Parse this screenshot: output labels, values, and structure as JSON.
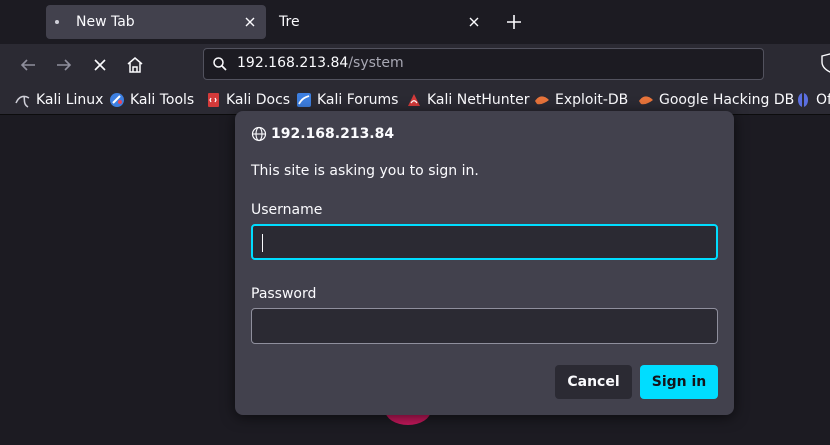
{
  "tabs": [
    {
      "title": "New Tab",
      "active": true
    },
    {
      "title": "Tre",
      "active": false
    }
  ],
  "urlbar": {
    "host": "192.168.213.84",
    "path": "/system"
  },
  "bookmarks": [
    {
      "label": "Kali Linux",
      "icon": "kali-dragon-icon"
    },
    {
      "label": "Kali Tools",
      "icon": "kali-tools-icon"
    },
    {
      "label": "Kali Docs",
      "icon": "kali-docs-icon"
    },
    {
      "label": "Kali Forums",
      "icon": "kali-forums-icon"
    },
    {
      "label": "Kali NetHunter",
      "icon": "nethunter-icon"
    },
    {
      "label": "Exploit-DB",
      "icon": "exploit-db-icon"
    },
    {
      "label": "Google Hacking DB",
      "icon": "ghdb-icon"
    },
    {
      "label": "Of",
      "icon": "offsec-icon"
    }
  ],
  "dialog": {
    "host": "192.168.213.84",
    "message": "This site is asking you to sign in.",
    "username_label": "Username",
    "username_value": "",
    "password_label": "Password",
    "password_value": "",
    "cancel_label": "Cancel",
    "signin_label": "Sign in"
  },
  "colors": {
    "accent": "#00ddff",
    "dialog_bg": "#42414d",
    "toolbar_bg": "#2b2a33",
    "page_bg": "#1c1b22"
  }
}
